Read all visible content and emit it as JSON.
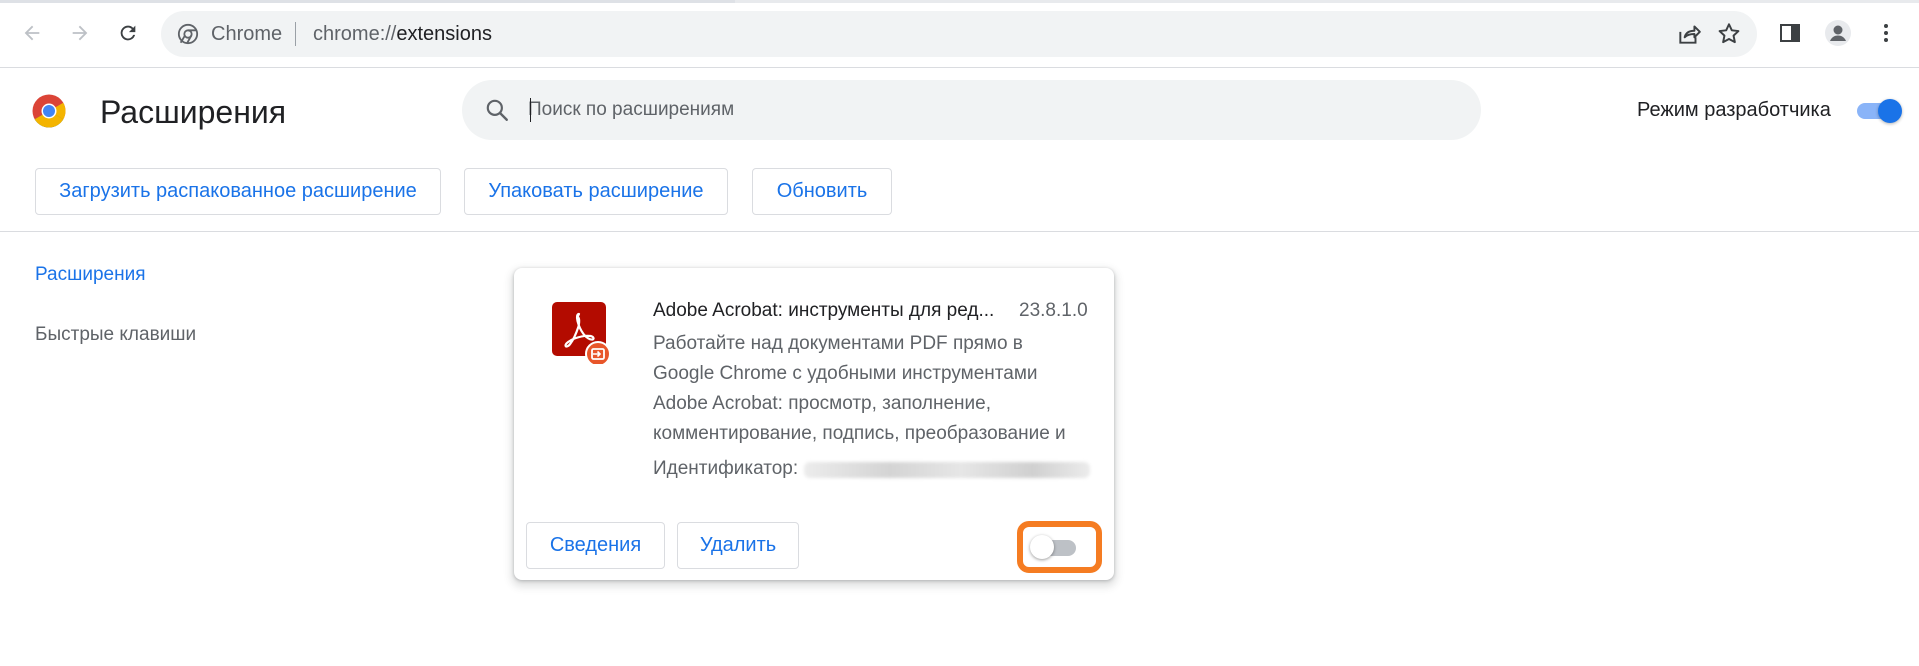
{
  "browser": {
    "omnibox": {
      "site_label": "Chrome",
      "url_scheme": "chrome://",
      "url_host": "extensions"
    },
    "icons": {
      "back": "back-arrow-icon",
      "forward": "forward-arrow-icon",
      "reload": "reload-icon",
      "site": "chrome-site-icon",
      "share": "share-icon",
      "bookmark": "star-icon",
      "side_panel": "side-panel-icon",
      "profile": "profile-icon",
      "menu": "more-vert-icon"
    }
  },
  "header": {
    "title": "Расширения",
    "search": {
      "placeholder": "Поиск по расширениям",
      "value": ""
    },
    "developer_mode": {
      "label": "Режим разработчика",
      "enabled": true
    }
  },
  "toolbar": {
    "load_unpacked_label": "Загрузить распакованное расширение",
    "pack_label": "Упаковать расширение",
    "update_label": "Обновить"
  },
  "sidebar": {
    "items": [
      {
        "label": "Расширения",
        "active": true
      },
      {
        "label": "Быстрые клавиши",
        "active": false
      }
    ]
  },
  "extension": {
    "name": "Adobe Acrobat: инструменты для ред...",
    "version": "23.8.1.0",
    "description_lines": [
      "Работайте над документами PDF прямо в",
      "Google Chrome с удобными инструментами",
      "Adobe Acrobat: просмотр, заполнение,",
      "комментирование, подпись, преобразование и"
    ],
    "id_label": "Идентификатор:",
    "details_label": "Сведения",
    "remove_label": "Удалить",
    "enabled": false
  },
  "colors": {
    "accent": "#1a73e8",
    "highlight": "#f57c22",
    "acrobat_red": "#b30b00",
    "badge_orange": "#e8562a"
  }
}
